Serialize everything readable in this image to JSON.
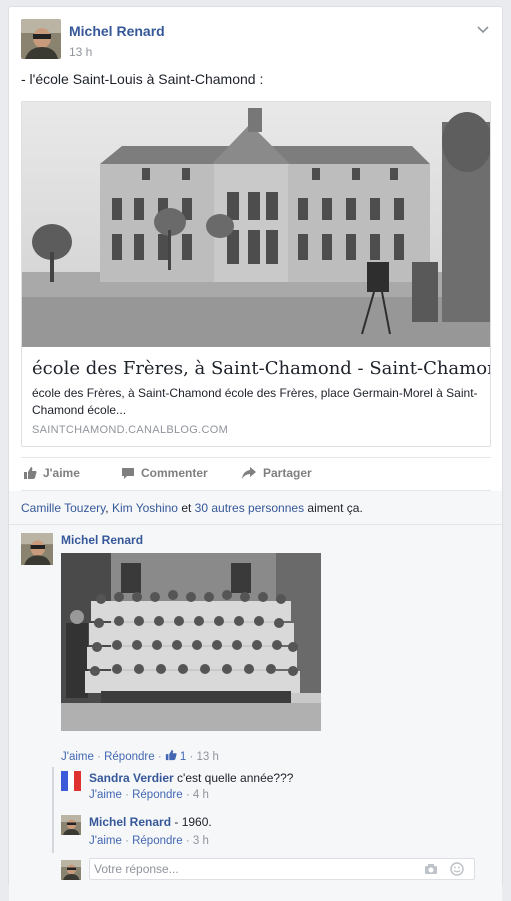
{
  "post": {
    "author": "Michel Renard",
    "time": "13 h",
    "text": "- l'école Saint-Louis à Saint-Chamond :"
  },
  "link": {
    "title": "école des Frères, à Saint-Chamond - Saint-Chamond",
    "description": "école des Frères, à Saint-Chamond école des Frères, place Germain-Morel à Saint-Chamond école...",
    "domain": "SAINTCHAMOND.CANALBLOG.COM"
  },
  "actions": {
    "like": "J'aime",
    "comment": "Commenter",
    "share": "Partager"
  },
  "likes": {
    "name1": "Camille Touzery",
    "comma": ", ",
    "name2": "Kim Yoshino",
    "and": " et ",
    "others": "30 autres personnes",
    "suffix": " aiment ça."
  },
  "comments": [
    {
      "author": "Michel Renard",
      "like": "J'aime",
      "dot": " · ",
      "reply": "Répondre",
      "reactions": "1",
      "time": "13 h"
    },
    {
      "author": "Sandra Verdier",
      "text": " c'est quelle année???",
      "like": "J'aime",
      "dot": " · ",
      "reply": "Répondre",
      "time": "4 h"
    },
    {
      "author": "Michel Renard",
      "text": " - 1960.",
      "like": "J'aime",
      "dot": " · ",
      "reply": "Répondre",
      "time": "3 h"
    }
  ],
  "reply_box": {
    "placeholder": "Votre réponse..."
  },
  "colors": {
    "link": "#365899",
    "meta": "#90949c",
    "background": "#e9ebee"
  }
}
